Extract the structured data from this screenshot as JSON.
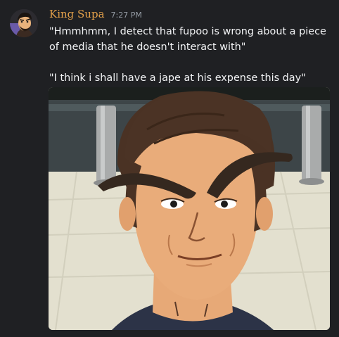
{
  "message": {
    "author": "King Supa",
    "timestamp": "7:27 PM",
    "line1": "\"Hmmhmm, I detect that fupoo is wrong about a piece of media that he doesn't interact with\"",
    "line2": "\"I think i shall have a jape at his expense this day\""
  },
  "colors": {
    "background": "#1f2023",
    "author": "#e3a04a",
    "timestamp": "#949ba4",
    "text": "#f2f3f5"
  },
  "icons": {
    "avatar": "cartoon-character-avatar"
  }
}
